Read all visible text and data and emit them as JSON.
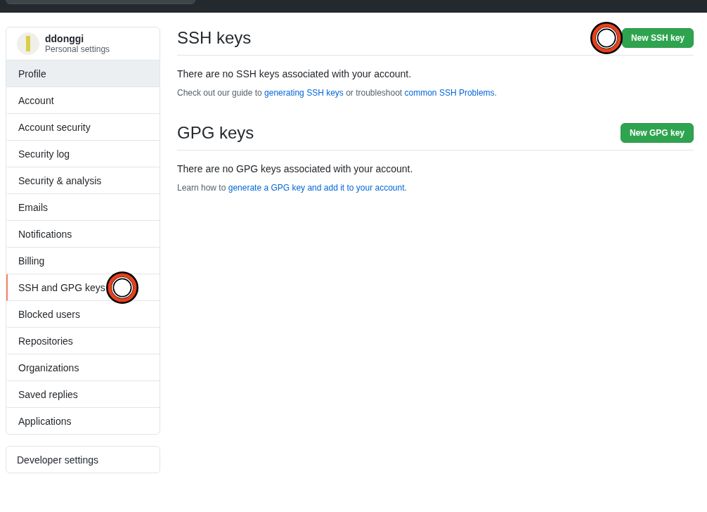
{
  "profile": {
    "username": "ddonggi",
    "subtitle": "Personal settings"
  },
  "nav": [
    {
      "label": "Profile",
      "selected": false,
      "hover": true,
      "marked": false
    },
    {
      "label": "Account",
      "selected": false,
      "hover": false,
      "marked": false
    },
    {
      "label": "Account security",
      "selected": false,
      "hover": false,
      "marked": false
    },
    {
      "label": "Security log",
      "selected": false,
      "hover": false,
      "marked": false
    },
    {
      "label": "Security & analysis",
      "selected": false,
      "hover": false,
      "marked": false
    },
    {
      "label": "Emails",
      "selected": false,
      "hover": false,
      "marked": false
    },
    {
      "label": "Notifications",
      "selected": false,
      "hover": false,
      "marked": false
    },
    {
      "label": "Billing",
      "selected": false,
      "hover": false,
      "marked": false
    },
    {
      "label": "SSH and GPG keys",
      "selected": true,
      "hover": false,
      "marked": true
    },
    {
      "label": "Blocked users",
      "selected": false,
      "hover": false,
      "marked": false
    },
    {
      "label": "Repositories",
      "selected": false,
      "hover": false,
      "marked": false
    },
    {
      "label": "Organizations",
      "selected": false,
      "hover": false,
      "marked": false
    },
    {
      "label": "Saved replies",
      "selected": false,
      "hover": false,
      "marked": false
    },
    {
      "label": "Applications",
      "selected": false,
      "hover": false,
      "marked": false
    }
  ],
  "developer_settings": "Developer settings",
  "sections": [
    {
      "title": "SSH keys",
      "button": "New SSH key",
      "marked": true,
      "empty_message": "There are no SSH keys associated with your account.",
      "help": [
        {
          "text": "Check out our guide to ",
          "kind": "text"
        },
        {
          "text": "generating SSH keys",
          "kind": "link"
        },
        {
          "text": " or troubleshoot ",
          "kind": "text"
        },
        {
          "text": "common SSH Problems",
          "kind": "link"
        },
        {
          "text": ".",
          "kind": "text"
        }
      ]
    },
    {
      "title": "GPG keys",
      "button": "New GPG key",
      "marked": false,
      "empty_message": "There are no GPG keys associated with your account.",
      "help": [
        {
          "text": "Learn how to ",
          "kind": "text"
        },
        {
          "text": "generate a GPG key and add it to your account",
          "kind": "link"
        },
        {
          "text": ".",
          "kind": "text"
        }
      ]
    }
  ]
}
